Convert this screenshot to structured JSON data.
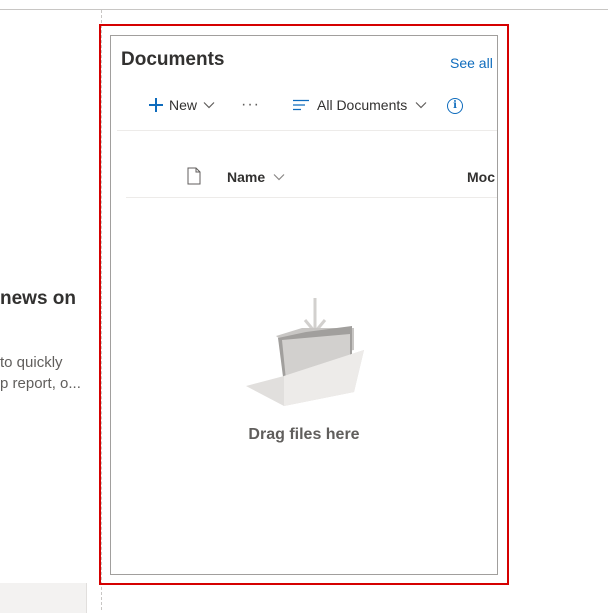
{
  "left_panel": {
    "title": "news on",
    "description": "to quickly\np report, o..."
  },
  "webpart": {
    "title": "Documents",
    "see_all": "See all"
  },
  "command_bar": {
    "new_label": "New",
    "more": "···",
    "view_label": "All Documents",
    "info_glyph": "i"
  },
  "columns": {
    "name": "Name",
    "modified": "Moc"
  },
  "empty_state": {
    "message": "Drag files here"
  },
  "colors": {
    "accent": "#0f6cbd",
    "selection_border": "#d50000"
  },
  "icons": [
    "plus-icon",
    "chevron-down-icon",
    "more-icon",
    "view-list-icon",
    "info-icon",
    "file-icon",
    "folder-icon",
    "arrow-down-icon"
  ]
}
